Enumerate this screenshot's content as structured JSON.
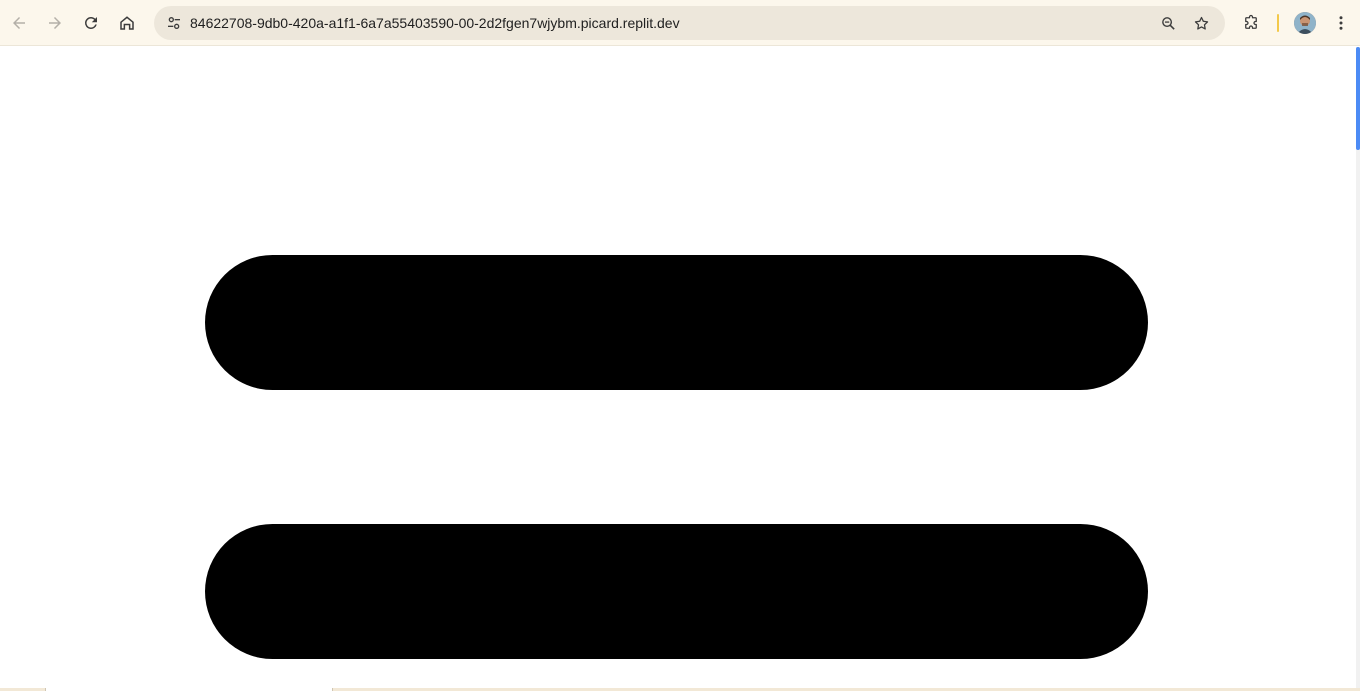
{
  "browser": {
    "url": "84622708-9db0-420a-a1f1-6a7a55403590-00-2d2fgen7wjybm.picard.replit.dev",
    "icons": {
      "back": "arrow-left-icon",
      "forward": "arrow-right-icon",
      "reload": "reload-icon",
      "home": "home-icon",
      "site_info": "tune-icon",
      "zoom": "zoom-icon",
      "bookmark": "star-icon",
      "extensions": "puzzle-icon",
      "menu": "kebab-menu-icon"
    },
    "colors": {
      "toolbar_bg": "#fcf7ec",
      "omnibox_bg": "#ede7db",
      "separator": "#f3c94a"
    }
  },
  "page": {
    "shapes": [
      {
        "kind": "pill",
        "color": "#000000"
      },
      {
        "kind": "pill",
        "color": "#000000"
      }
    ]
  },
  "scrollbar": {
    "thumb_color": "#4c8bf5"
  }
}
